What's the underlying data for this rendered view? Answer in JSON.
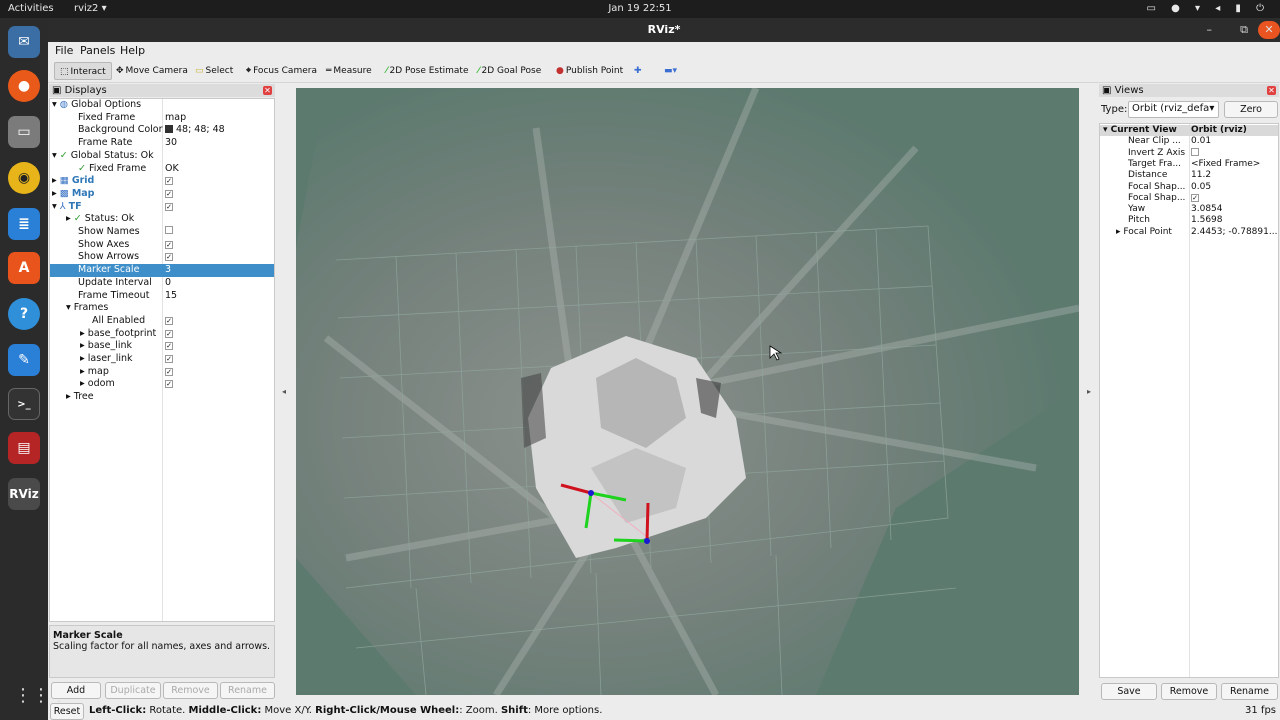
{
  "topbar": {
    "activities": "Activities",
    "app": "rviz2 ▾",
    "clock": "Jan 19  22:51",
    "tray": "▭ ● ▾ ◂ ▮ ⏻"
  },
  "window": {
    "title": "RViz*"
  },
  "menu": {
    "file": "File",
    "panels": "Panels",
    "help": "Help"
  },
  "toolbar": {
    "interact": "Interact",
    "move_camera": "Move Camera",
    "select": "Select",
    "focus_camera": "Focus Camera",
    "measure": "Measure",
    "pose_estimate": "2D Pose Estimate",
    "goal_pose": "2D Goal Pose",
    "publish_point": "Publish Point"
  },
  "displays": {
    "title": "Displays",
    "rows": [
      {
        "name": "Global Options",
        "value": ""
      },
      {
        "name": "Fixed Frame",
        "value": "map"
      },
      {
        "name": "Background Color",
        "value": "48; 48; 48"
      },
      {
        "name": "Frame Rate",
        "value": "30"
      },
      {
        "name": "Global Status: Ok",
        "value": ""
      },
      {
        "name": "Fixed Frame",
        "value": "OK"
      },
      {
        "name": "Grid",
        "value": ""
      },
      {
        "name": "Map",
        "value": ""
      },
      {
        "name": "TF",
        "value": ""
      },
      {
        "name": "Status: Ok",
        "value": ""
      },
      {
        "name": "Show Names",
        "value": ""
      },
      {
        "name": "Show Axes",
        "value": ""
      },
      {
        "name": "Show Arrows",
        "value": ""
      },
      {
        "name": "Marker Scale",
        "value": "3"
      },
      {
        "name": "Update Interval",
        "value": "0"
      },
      {
        "name": "Frame Timeout",
        "value": "15"
      },
      {
        "name": "Frames",
        "value": ""
      },
      {
        "name": "All Enabled",
        "value": ""
      },
      {
        "name": "base_footprint",
        "value": ""
      },
      {
        "name": "base_link",
        "value": ""
      },
      {
        "name": "laser_link",
        "value": ""
      },
      {
        "name": "map",
        "value": ""
      },
      {
        "name": "odom",
        "value": ""
      },
      {
        "name": "Tree",
        "value": ""
      }
    ],
    "description_title": "Marker Scale",
    "description_text": "Scaling factor for all names, axes and arrows.",
    "buttons": {
      "add": "Add",
      "duplicate": "Duplicate",
      "remove": "Remove",
      "rename": "Rename"
    }
  },
  "views": {
    "title": "Views",
    "type_label": "Type:",
    "type_value": "Orbit (rviz_defa▾",
    "zero": "Zero",
    "header": {
      "name": "Current View",
      "value": "Orbit (rviz)"
    },
    "rows": [
      {
        "name": "Near Clip ...",
        "value": "0.01"
      },
      {
        "name": "Invert Z Axis",
        "value": ""
      },
      {
        "name": "Target Fra...",
        "value": "<Fixed Frame>"
      },
      {
        "name": "Distance",
        "value": "11.2"
      },
      {
        "name": "Focal Shap...",
        "value": "0.05"
      },
      {
        "name": "Focal Shap...",
        "value": ""
      },
      {
        "name": "Yaw",
        "value": "3.0854"
      },
      {
        "name": "Pitch",
        "value": "1.5698"
      },
      {
        "name": "Focal Point",
        "value": "2.4453; -0.78891..."
      }
    ],
    "buttons": {
      "save": "Save",
      "remove": "Remove",
      "rename": "Rename"
    }
  },
  "status": {
    "reset": "Reset",
    "left_click": "Left-Click:",
    "left_text": " Rotate. ",
    "middle_click": "Middle-Click:",
    "middle_text": " Move X/Y. ",
    "right_click": "Right-Click/Mouse Wheel:",
    "right_text": ": Zoom. ",
    "shift": "Shift",
    "shift_text": ": More options.",
    "fps": "31 fps"
  }
}
